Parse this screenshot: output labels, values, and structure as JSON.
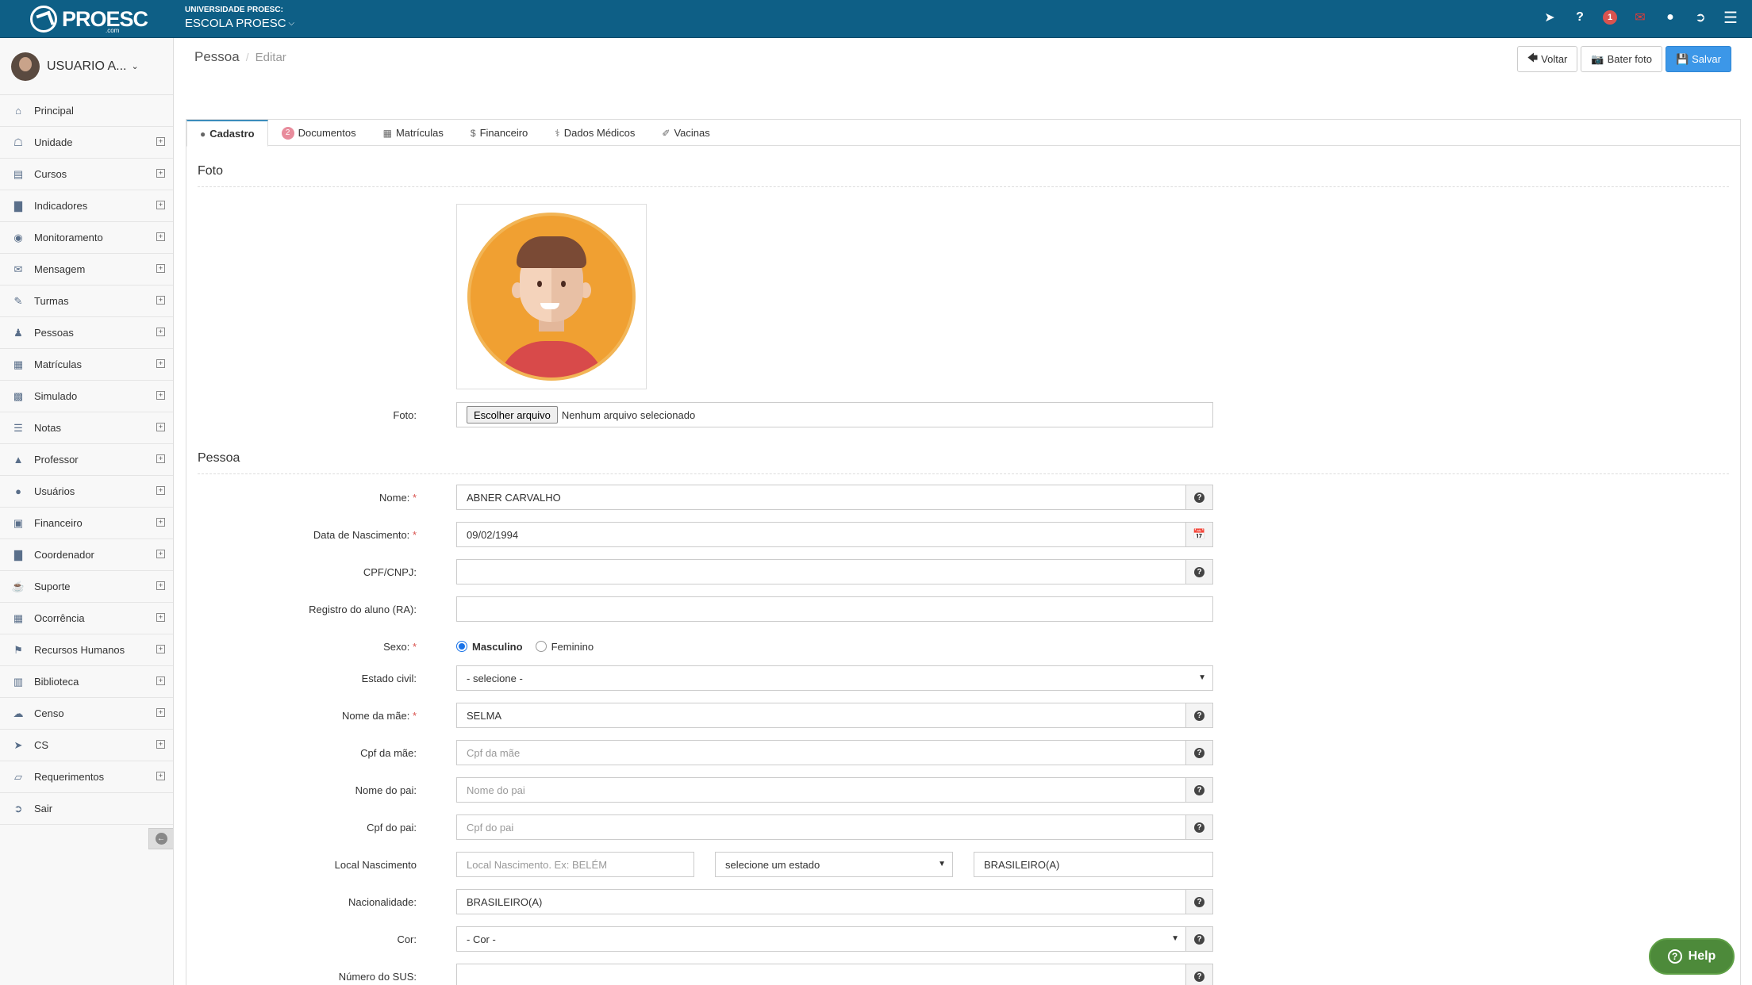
{
  "header": {
    "logo_text": "PROESC",
    "logo_sub": ".com",
    "university_label": "UNIVERSIDADE PROESC:",
    "school_name": "ESCOLA PROESC",
    "notification_count": "1",
    "icons": [
      "rocket-icon",
      "question-icon",
      "notification-badge",
      "mail-icon",
      "user-icon",
      "logout-icon",
      "menu-icon"
    ],
    "accent_color": "#0e5f86"
  },
  "sidebar": {
    "user_name": "USUARIO A...",
    "items": [
      {
        "label": "Principal",
        "icon": "home-icon",
        "expandable": false
      },
      {
        "label": "Unidade",
        "icon": "bank-icon",
        "expandable": true
      },
      {
        "label": "Cursos",
        "icon": "book-icon",
        "expandable": true
      },
      {
        "label": "Indicadores",
        "icon": "bar-chart-icon",
        "expandable": true
      },
      {
        "label": "Monitoramento",
        "icon": "eye-icon",
        "expandable": true
      },
      {
        "label": "Mensagem",
        "icon": "envelope-icon",
        "expandable": true
      },
      {
        "label": "Turmas",
        "icon": "pencil-icon",
        "expandable": true
      },
      {
        "label": "Pessoas",
        "icon": "users-icon",
        "expandable": true
      },
      {
        "label": "Matrículas",
        "icon": "newspaper-icon",
        "expandable": true
      },
      {
        "label": "Simulado",
        "icon": "puzzle-icon",
        "expandable": true
      },
      {
        "label": "Notas",
        "icon": "list-icon",
        "expandable": true
      },
      {
        "label": "Professor",
        "icon": "graduation-cap-icon",
        "expandable": true
      },
      {
        "label": "Usuários",
        "icon": "user-icon",
        "expandable": true
      },
      {
        "label": "Financeiro",
        "icon": "money-icon",
        "expandable": true
      },
      {
        "label": "Coordenador",
        "icon": "bar-chart-icon",
        "expandable": true
      },
      {
        "label": "Suporte",
        "icon": "coffee-icon",
        "expandable": true
      },
      {
        "label": "Ocorrência",
        "icon": "calendar-icon",
        "expandable": true
      },
      {
        "label": "Recursos Humanos",
        "icon": "flag-icon",
        "expandable": true
      },
      {
        "label": "Biblioteca",
        "icon": "bookshelf-icon",
        "expandable": true
      },
      {
        "label": "Censo",
        "icon": "cloud-download-icon",
        "expandable": true
      },
      {
        "label": "CS",
        "icon": "rocket-icon",
        "expandable": true
      },
      {
        "label": "Requerimentos",
        "icon": "folder-open-icon",
        "expandable": true
      },
      {
        "label": "Sair",
        "icon": "sign-out-icon",
        "expandable": false
      }
    ]
  },
  "breadcrumb": {
    "current": "Pessoa",
    "sub": "Editar"
  },
  "actions": {
    "back": "Voltar",
    "photo": "Bater foto",
    "save": "Salvar"
  },
  "tabs": [
    {
      "label": "Cadastro",
      "icon": "user-icon",
      "active": true
    },
    {
      "label": "Documentos",
      "badge": "2",
      "active": false
    },
    {
      "label": "Matrículas",
      "icon": "newspaper-icon",
      "active": false
    },
    {
      "label": "Financeiro",
      "icon": "dollar-icon",
      "active": false
    },
    {
      "label": "Dados Médicos",
      "icon": "stethoscope-icon",
      "active": false
    },
    {
      "label": "Vacinas",
      "icon": "syringe-icon",
      "active": false
    }
  ],
  "foto_section": {
    "title": "Foto",
    "file_label": "Foto:",
    "file_button": "Escolher arquivo",
    "file_status": "Nenhum arquivo selecionado"
  },
  "pessoa_section": {
    "title": "Pessoa",
    "nome": {
      "label": "Nome:",
      "value": "ABNER CARVALHO"
    },
    "nascimento": {
      "label": "Data de Nascimento:",
      "value": "09/02/1994"
    },
    "cpf": {
      "label": "CPF/CNPJ:",
      "value": ""
    },
    "ra": {
      "label": "Registro do aluno (RA):",
      "value": ""
    },
    "sexo": {
      "label": "Sexo:",
      "options": [
        "Masculino",
        "Feminino"
      ],
      "selected": "Masculino"
    },
    "estado_civil": {
      "label": "Estado civil:",
      "value": "- selecione -"
    },
    "mae": {
      "label": "Nome da mãe:",
      "value": "SELMA"
    },
    "cpf_mae": {
      "label": "Cpf da mãe:",
      "placeholder": "Cpf da mãe"
    },
    "pai": {
      "label": "Nome do pai:",
      "placeholder": "Nome do pai"
    },
    "cpf_pai": {
      "label": "Cpf do pai:",
      "placeholder": "Cpf do pai"
    },
    "local_nasc": {
      "label": "Local Nascimento",
      "placeholder": "Local Nascimento. Ex: BELÉM",
      "estado": "selecione um estado",
      "nacionalidade": "BRASILEIRO(A)"
    },
    "nacionalidade": {
      "label": "Nacionalidade:",
      "value": "BRASILEIRO(A)"
    },
    "cor": {
      "label": "Cor:",
      "value": "- Cor -"
    },
    "sus": {
      "label": "Número do SUS:",
      "value": ""
    }
  },
  "help": {
    "label": "Help"
  }
}
